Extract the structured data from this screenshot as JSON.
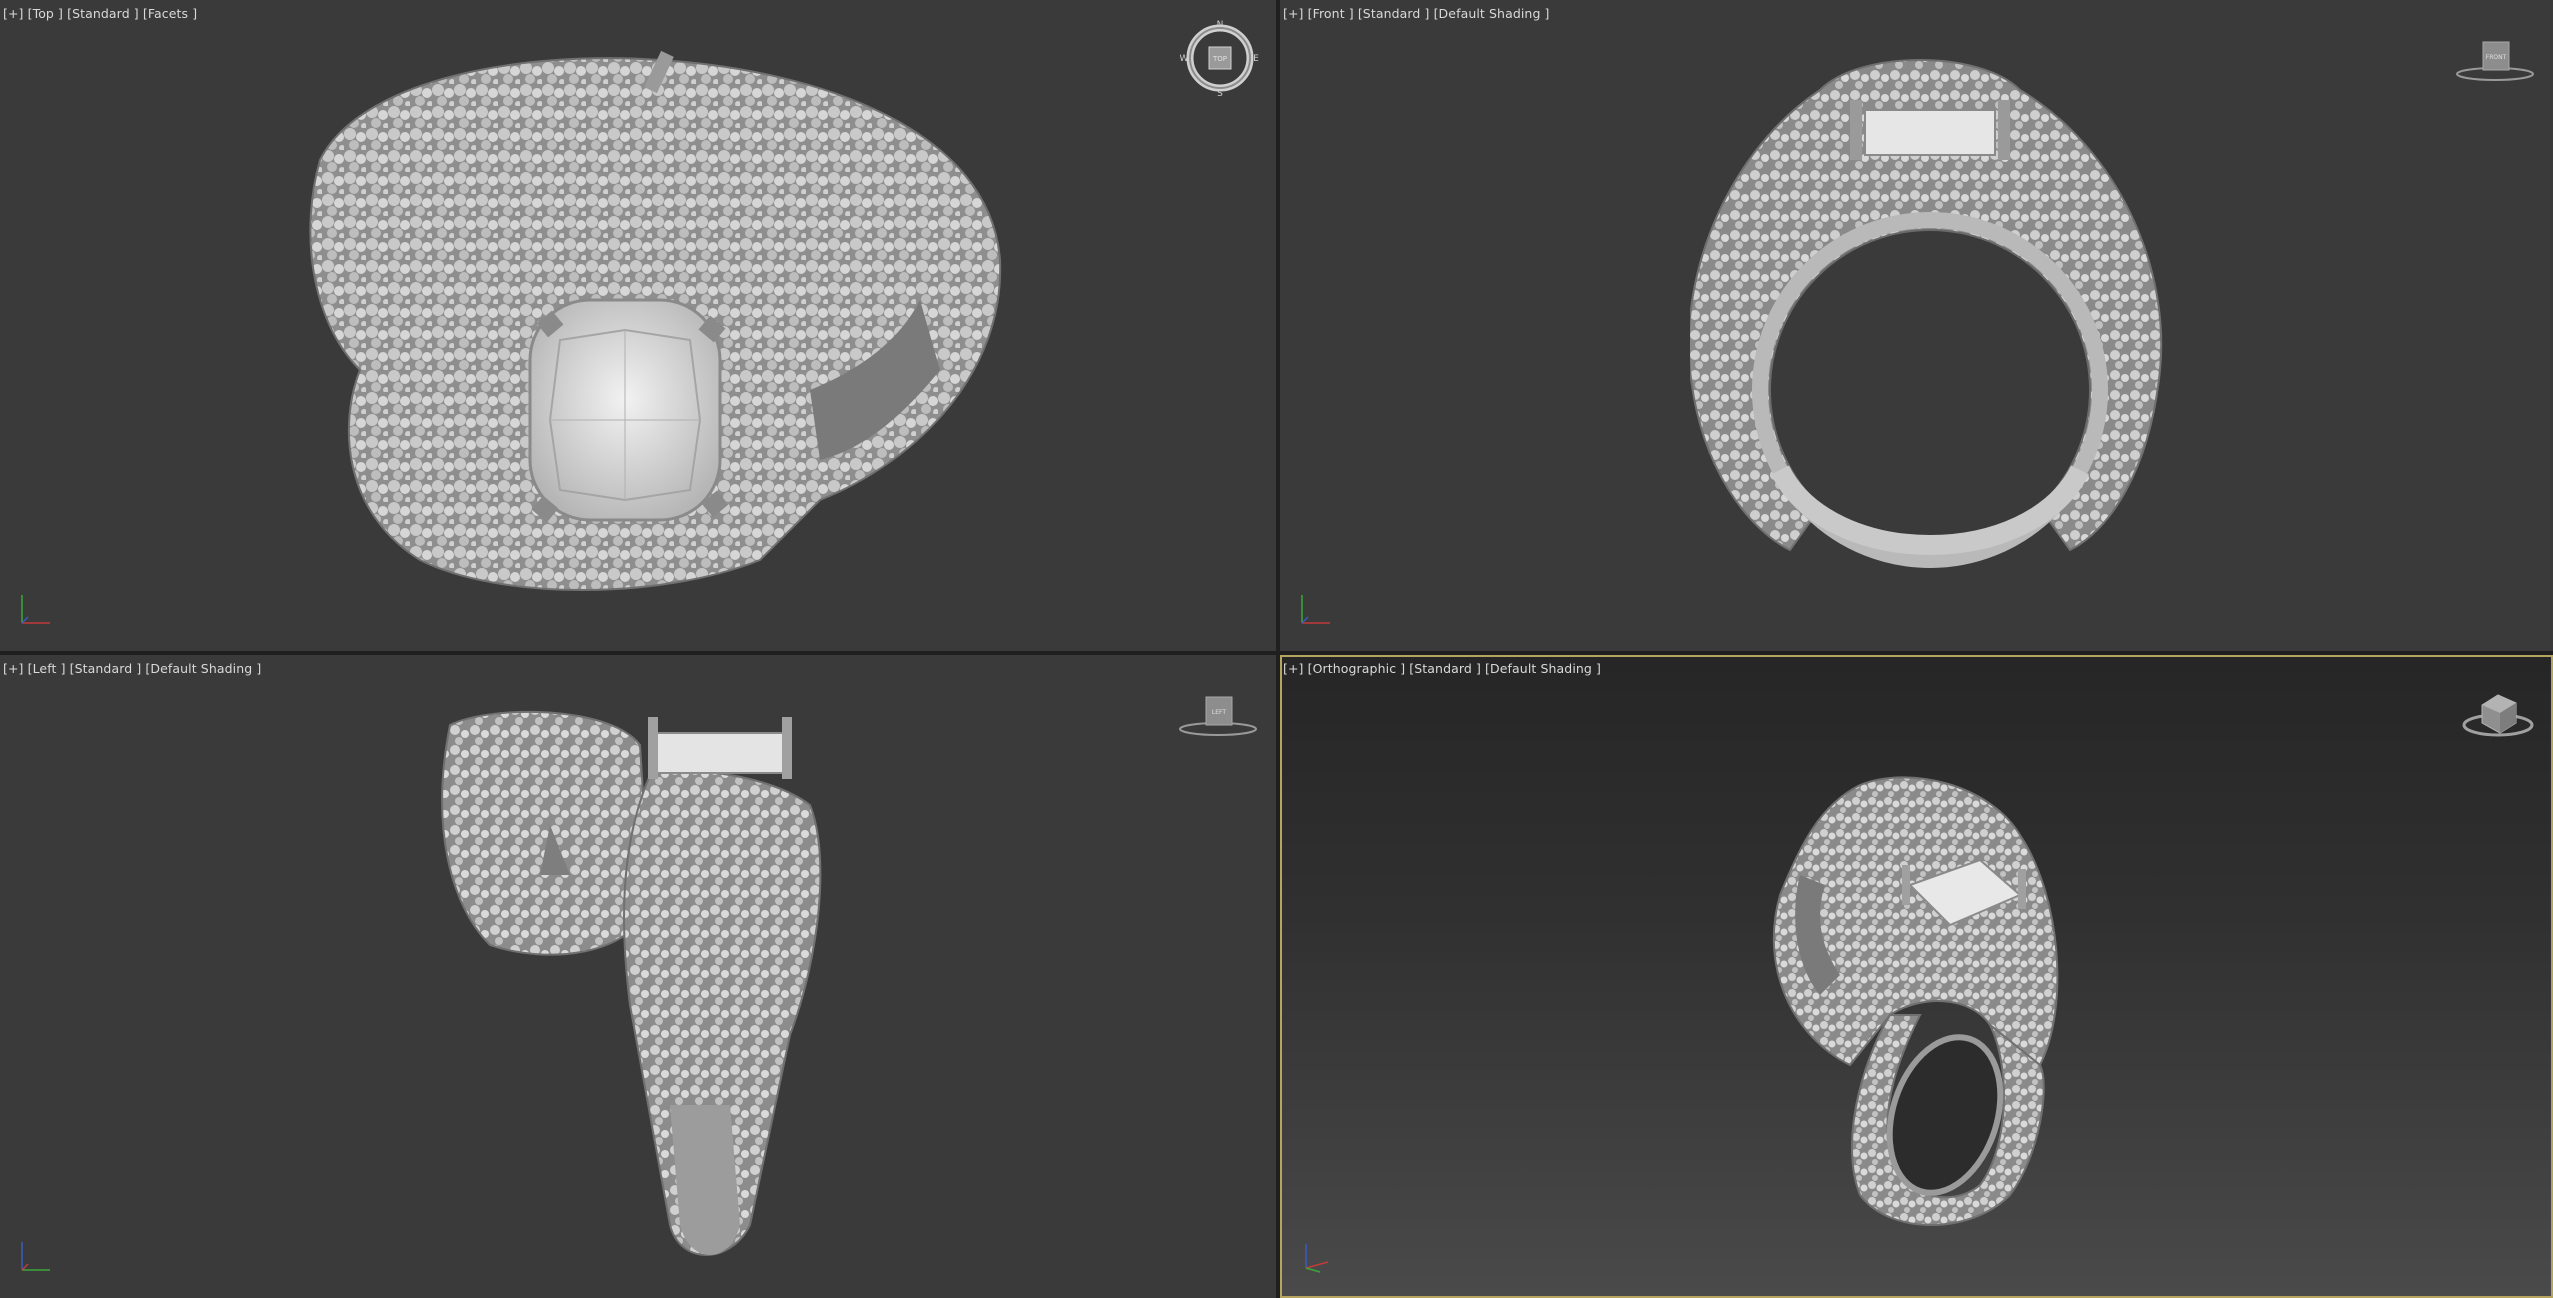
{
  "viewports": {
    "top": {
      "label": "[+] [Top ] [Standard ] [Facets ]",
      "gizmo_text": "TOP",
      "compass": {
        "n": "N",
        "s": "S",
        "e": "E",
        "w": "W"
      }
    },
    "front": {
      "label": "[+] [Front ] [Standard ] [Default Shading ]",
      "gizmo_text": "FRONT"
    },
    "left": {
      "label": "[+] [Left ] [Standard ] [Default Shading ]",
      "gizmo_text": "LEFT"
    },
    "perspective": {
      "label": "[+] [Orthographic ] [Standard ] [Default Shading ]",
      "active": true
    }
  },
  "colors": {
    "viewport_bg": "#3a3a3a",
    "active_border": "#b7a45e",
    "model": "#c8c8c8"
  },
  "icons": [
    "view-cube-icon",
    "compass-icon",
    "axis-tripod-icon"
  ]
}
